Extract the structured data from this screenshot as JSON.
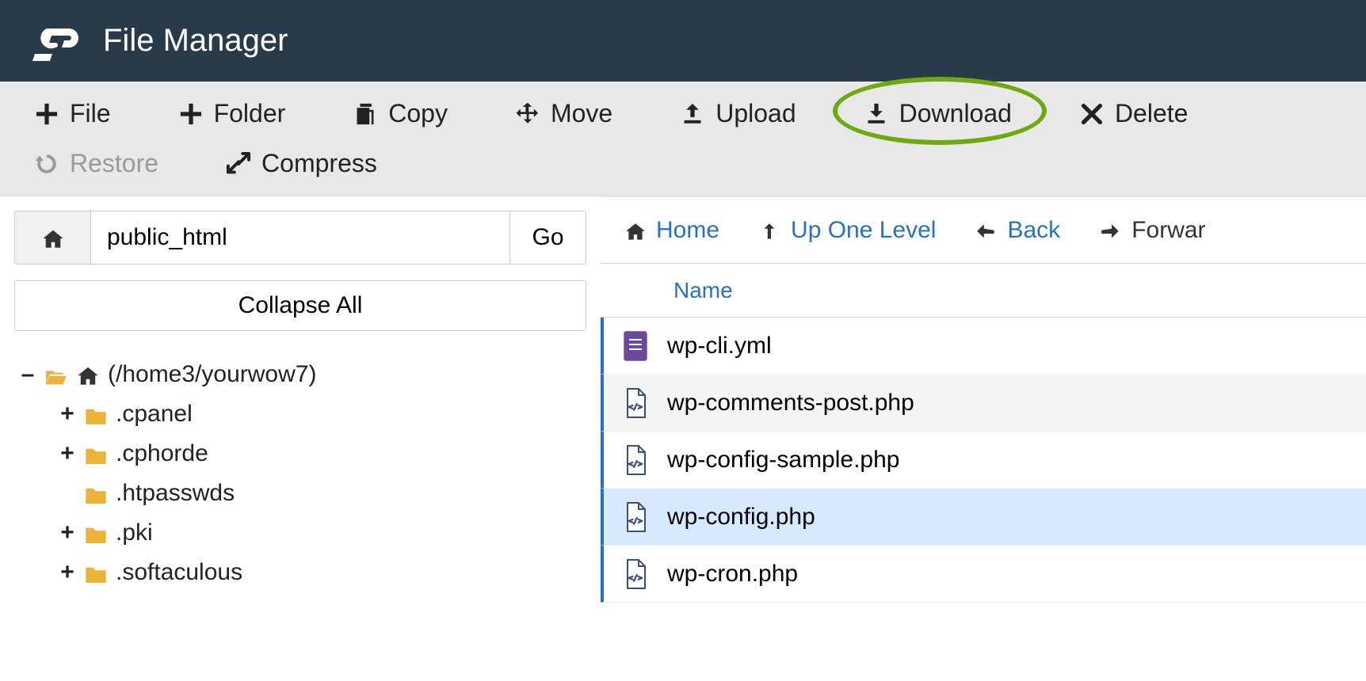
{
  "header": {
    "title": "File Manager"
  },
  "toolbar": {
    "items": [
      {
        "id": "file",
        "label": "File",
        "icon": "plus",
        "disabled": false
      },
      {
        "id": "folder",
        "label": "Folder",
        "icon": "plus",
        "disabled": false
      },
      {
        "id": "copy",
        "label": "Copy",
        "icon": "copy",
        "disabled": false
      },
      {
        "id": "move",
        "label": "Move",
        "icon": "move",
        "disabled": false
      },
      {
        "id": "upload",
        "label": "Upload",
        "icon": "upload",
        "disabled": false
      },
      {
        "id": "download",
        "label": "Download",
        "icon": "download",
        "disabled": false,
        "highlighted": true
      },
      {
        "id": "delete",
        "label": "Delete",
        "icon": "delete",
        "disabled": false
      },
      {
        "id": "restore",
        "label": "Restore",
        "icon": "restore",
        "disabled": true
      },
      {
        "id": "compress",
        "label": "Compress",
        "icon": "compress",
        "disabled": false
      }
    ]
  },
  "location": {
    "path": "public_html",
    "go_label": "Go",
    "collapse_label": "Collapse All"
  },
  "tree": {
    "root": {
      "label": "(/home3/yourwow7)",
      "expanded": true
    },
    "children": [
      {
        "label": ".cpanel",
        "expandable": true
      },
      {
        "label": ".cphorde",
        "expandable": true
      },
      {
        "label": ".htpasswds",
        "expandable": false
      },
      {
        "label": ".pki",
        "expandable": true
      },
      {
        "label": ".softaculous",
        "expandable": true
      }
    ]
  },
  "breadcrumb": {
    "items": [
      {
        "id": "home",
        "label": "Home",
        "icon": "home"
      },
      {
        "id": "up",
        "label": "Up One Level",
        "icon": "up"
      },
      {
        "id": "back",
        "label": "Back",
        "icon": "back"
      },
      {
        "id": "forward",
        "label": "Forwar",
        "icon": "forward",
        "truncated": true,
        "dark": true
      }
    ]
  },
  "file_table": {
    "columns": {
      "name": "Name"
    },
    "rows": [
      {
        "name": "wp-cli.yml",
        "icon": "doc-purple",
        "alt": false,
        "selected": false
      },
      {
        "name": "wp-comments-post.php",
        "icon": "doc-code",
        "alt": true,
        "selected": false
      },
      {
        "name": "wp-config-sample.php",
        "icon": "doc-code",
        "alt": false,
        "selected": false
      },
      {
        "name": "wp-config.php",
        "icon": "doc-code",
        "alt": false,
        "selected": true
      },
      {
        "name": "wp-cron.php",
        "icon": "doc-code",
        "alt": false,
        "selected": false
      }
    ]
  },
  "colors": {
    "header_bg": "#293a4a",
    "link": "#2472c8",
    "folder": "#eab33a",
    "highlight_ring": "#6fa910",
    "selection_bg": "#d6e9ff"
  }
}
